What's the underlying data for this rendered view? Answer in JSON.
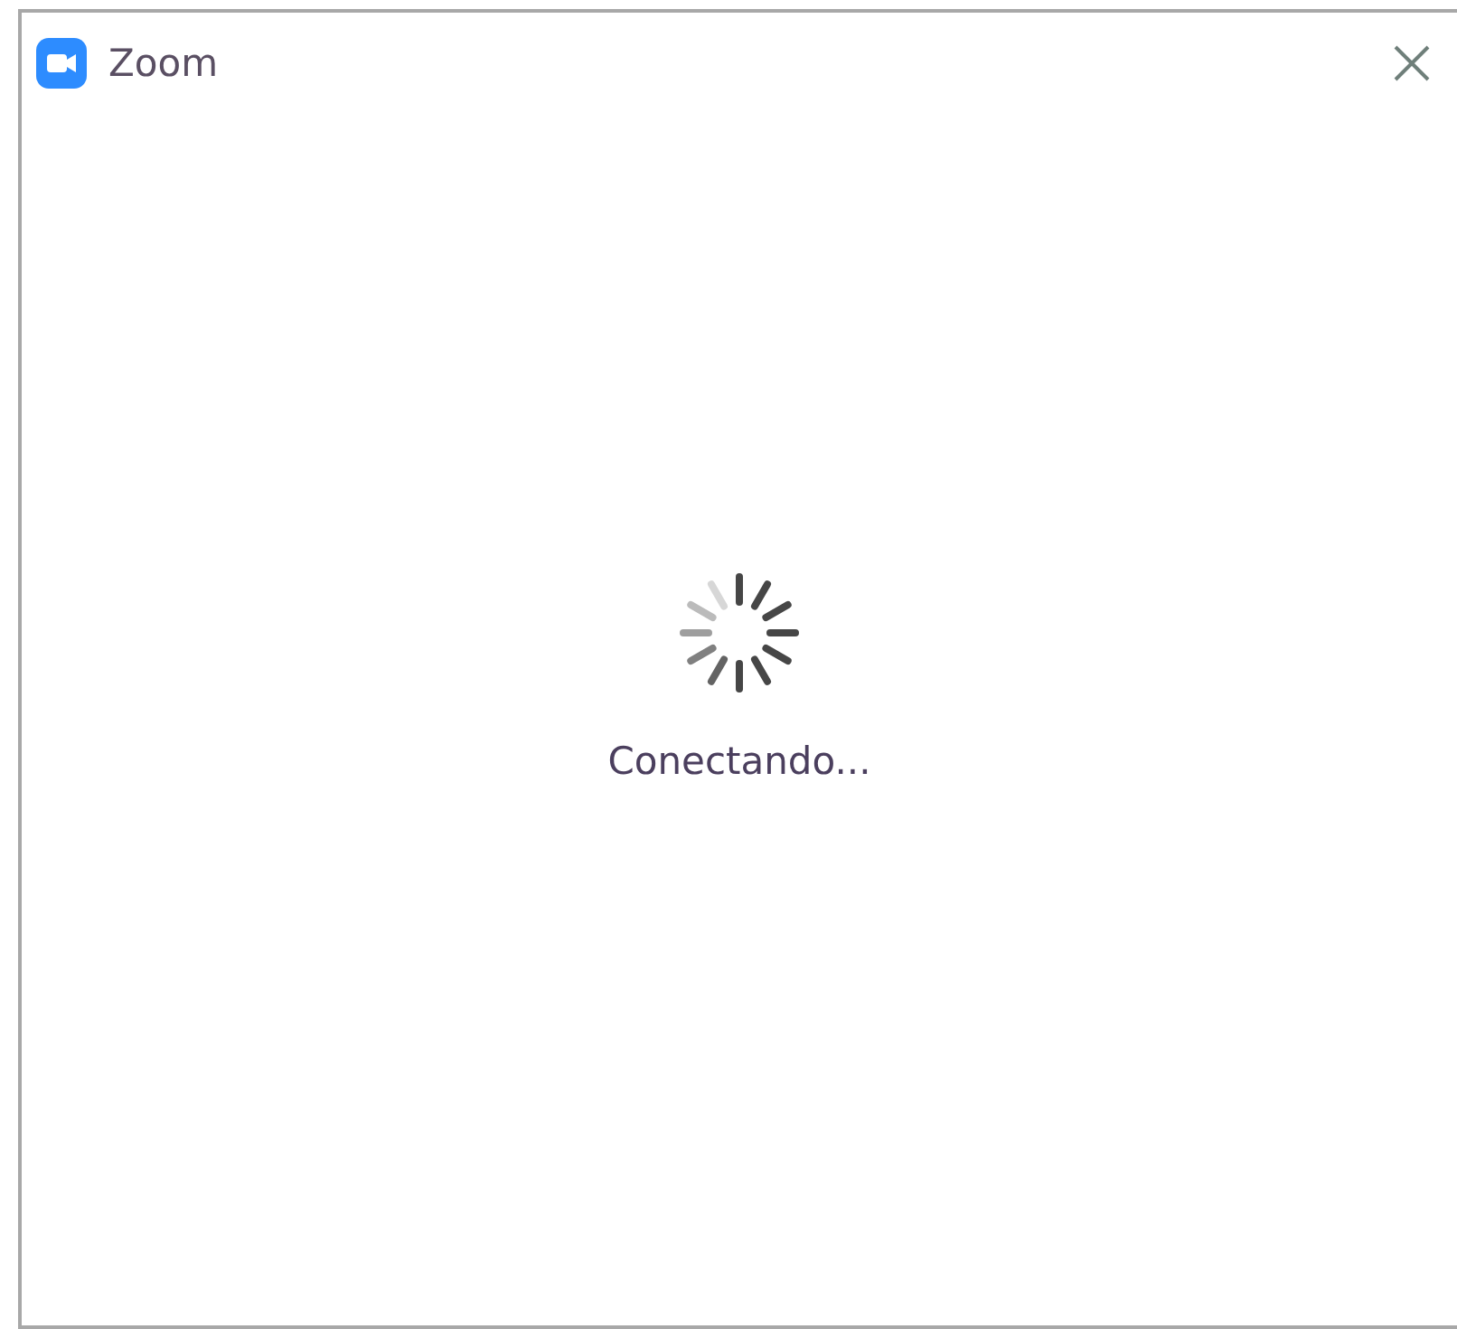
{
  "window": {
    "title": "Zoom"
  },
  "status": {
    "message": "Conectando..."
  }
}
